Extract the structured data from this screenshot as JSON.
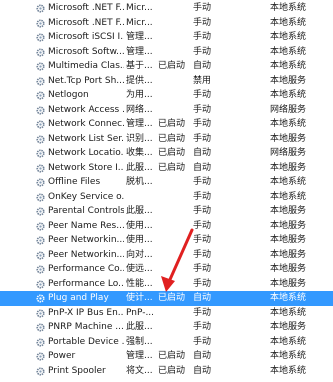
{
  "services": [
    {
      "name": "Microsoft .NET F...",
      "description": "Micr...",
      "status": "",
      "startup": "手动",
      "logon": "本地系统"
    },
    {
      "name": "Microsoft .NET F...",
      "description": "Micr...",
      "status": "",
      "startup": "手动",
      "logon": "本地系统"
    },
    {
      "name": "Microsoft iSCSI I...",
      "description": "管理...",
      "status": "",
      "startup": "手动",
      "logon": "本地系统"
    },
    {
      "name": "Microsoft Softw...",
      "description": "管理...",
      "status": "",
      "startup": "手动",
      "logon": "本地系统"
    },
    {
      "name": "Multimedia Clas...",
      "description": "基于...",
      "status": "已启动",
      "startup": "自动",
      "logon": "本地系统"
    },
    {
      "name": "Net.Tcp Port Sh...",
      "description": "提供...",
      "status": "",
      "startup": "禁用",
      "logon": "本地服务"
    },
    {
      "name": "Netlogon",
      "description": "为用...",
      "status": "",
      "startup": "手动",
      "logon": "本地系统"
    },
    {
      "name": "Network Access ...",
      "description": "网络...",
      "status": "",
      "startup": "手动",
      "logon": "网络服务"
    },
    {
      "name": "Network Connec...",
      "description": "管理...",
      "status": "已启动",
      "startup": "手动",
      "logon": "本地系统"
    },
    {
      "name": "Network List Ser...",
      "description": "识别...",
      "status": "已启动",
      "startup": "手动",
      "logon": "本地服务"
    },
    {
      "name": "Network Locatio...",
      "description": "收集...",
      "status": "已启动",
      "startup": "自动",
      "logon": "网络服务"
    },
    {
      "name": "Network Store I...",
      "description": "此服...",
      "status": "已启动",
      "startup": "自动",
      "logon": "本地服务"
    },
    {
      "name": "Offline Files",
      "description": "脱机...",
      "status": "",
      "startup": "手动",
      "logon": "本地系统"
    },
    {
      "name": "OnKey Service o...",
      "description": "",
      "status": "",
      "startup": "手动",
      "logon": "本地系统"
    },
    {
      "name": "Parental Controls",
      "description": "此服...",
      "status": "",
      "startup": "手动",
      "logon": "本地服务"
    },
    {
      "name": "Peer Name Res...",
      "description": "使用...",
      "status": "",
      "startup": "手动",
      "logon": "本地服务"
    },
    {
      "name": "Peer Networkin...",
      "description": "使用...",
      "status": "",
      "startup": "手动",
      "logon": "本地服务"
    },
    {
      "name": "Peer Networkin...",
      "description": "向对...",
      "status": "",
      "startup": "手动",
      "logon": "本地服务"
    },
    {
      "name": "Performance Co...",
      "description": "使远...",
      "status": "",
      "startup": "手动",
      "logon": "本地服务"
    },
    {
      "name": "Performance Lo...",
      "description": "性能...",
      "status": "",
      "startup": "手动",
      "logon": "本地服务"
    },
    {
      "name": "Plug and Play",
      "description": "使计...",
      "status": "已启动",
      "startup": "自动",
      "logon": "本地系统",
      "selected": true
    },
    {
      "name": "PnP-X IP Bus En...",
      "description": "PnP-...",
      "status": "",
      "startup": "手动",
      "logon": "本地系统"
    },
    {
      "name": "PNRP Machine ...",
      "description": "此服...",
      "status": "",
      "startup": "手动",
      "logon": "本地服务"
    },
    {
      "name": "Portable Device ...",
      "description": "强制...",
      "status": "",
      "startup": "手动",
      "logon": "本地系统"
    },
    {
      "name": "Power",
      "description": "管理...",
      "status": "已启动",
      "startup": "自动",
      "logon": "本地系统"
    },
    {
      "name": "Print Spooler",
      "description": "将文...",
      "status": "已启动",
      "startup": "自动",
      "logon": "本地系统"
    }
  ],
  "colors": {
    "selected_bg": "#3399ff",
    "annotation_arrow": "#e02020"
  }
}
